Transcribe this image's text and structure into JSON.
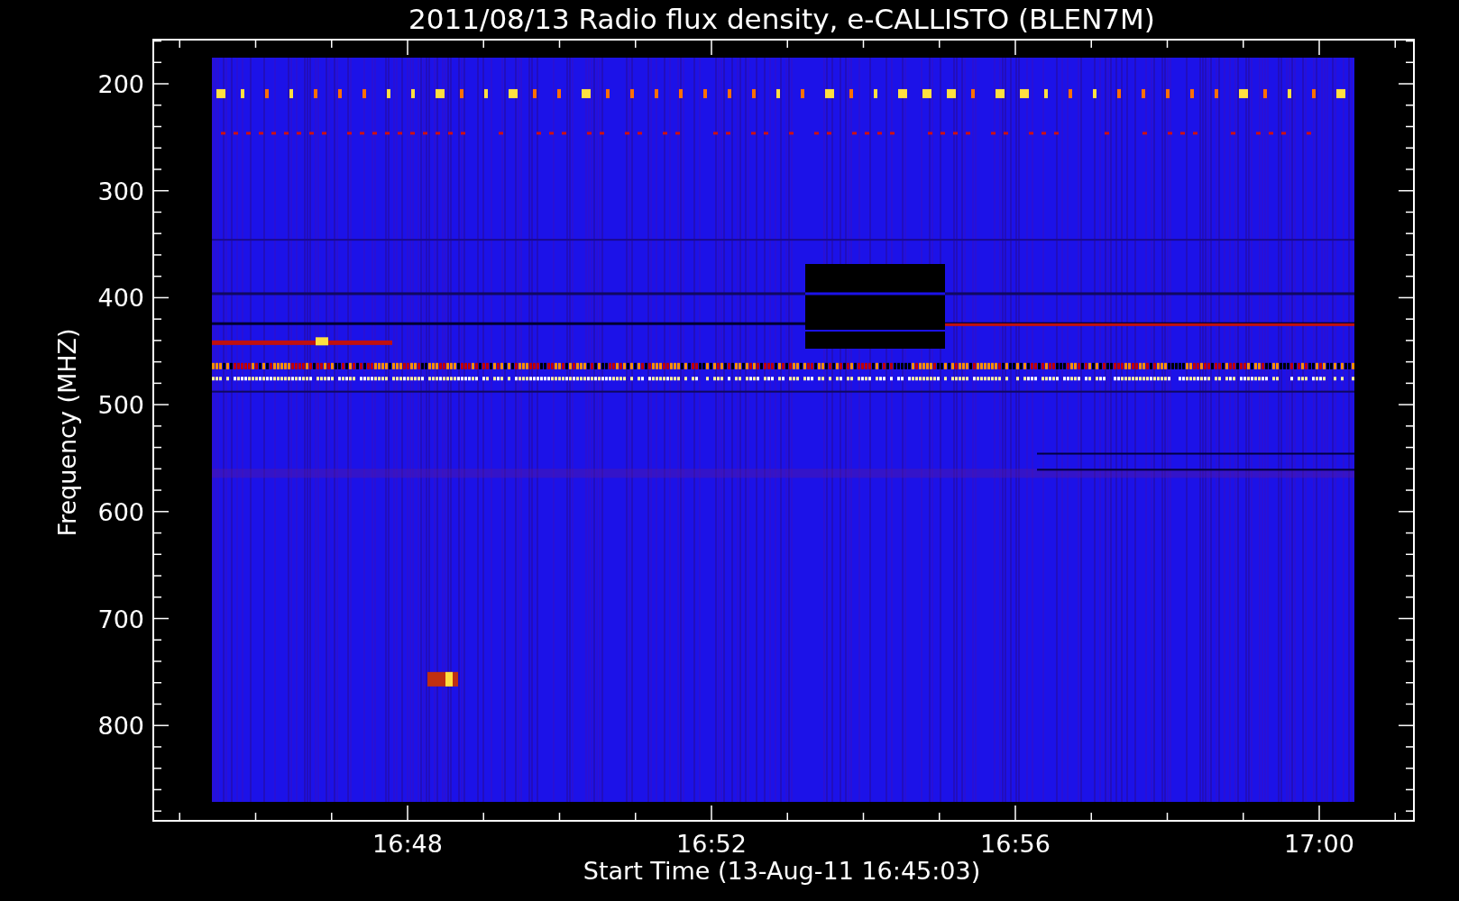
{
  "plot": {
    "title": "2011/08/13  Radio flux density, e-CALLISTO (BLEN7M)",
    "y_axis": {
      "label": "Frequency (MHZ)",
      "ticks": [
        "200",
        "300",
        "400",
        "500",
        "600",
        "700",
        "800"
      ]
    },
    "x_axis": {
      "label": "Start Time (13-Aug-11 16:45:03)",
      "ticks": [
        "16:48",
        "16:52",
        "16:56",
        "17:00"
      ]
    }
  }
}
